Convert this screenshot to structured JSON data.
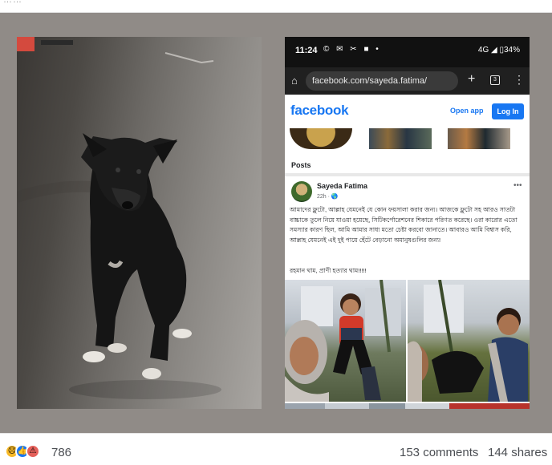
{
  "topbar": {
    "ellipsis": "……"
  },
  "phone": {
    "status": {
      "time": "11:24",
      "icons_left": "© ✉ ✂ ■ •",
      "icons_right": "4G ◢ ▯34%"
    },
    "browser": {
      "url": "facebook.com/sayeda.fatima/",
      "home_icon": "home-icon",
      "tabs_count": "3"
    },
    "facebook": {
      "logo": "facebook",
      "open_app_label": "Open app",
      "login_label": "Log In"
    },
    "posts_heading": "Posts",
    "post": {
      "author": "Sayeda Fatima",
      "meta": "22h · 🌎",
      "more_icon": "•••",
      "body": "আমাদের ফ্লুটো, আল্লাহ যেমনেই যে কোন ফয়সালা করার জন্য। আজকে ফ্লুটো সহ আরও সাতটা বাচ্চাকে তুলে নিয়ে যাওয়া হয়েছে, সিটিকর্পোরেশনের শিকারে পরিণত করেছে। ওরা কারোর এতো সমস্যার কারণ ছিল, আমি আমার সাধ্য মতো চেষ্টা করবো জানাতে। আবারও আমি বিশ্বাস করি, আল্লাহ যেমনেই এই দুই পায়ে হেঁটে বেড়ানো অমানুষগুলির জন্য!",
      "signature": "রহমান থাম, প্রাণী হত্যার থাম!!!!!"
    }
  },
  "footer": {
    "reaction_count": "786",
    "comments": "153 comments",
    "shares": "144 shares",
    "reaction_icons": [
      "sad-reaction-icon",
      "like-reaction-icon",
      "angry-reaction-icon"
    ]
  },
  "colors": {
    "facebook_blue": "#1877f2",
    "canvas_gray": "#908b87",
    "status_black": "#111111"
  }
}
